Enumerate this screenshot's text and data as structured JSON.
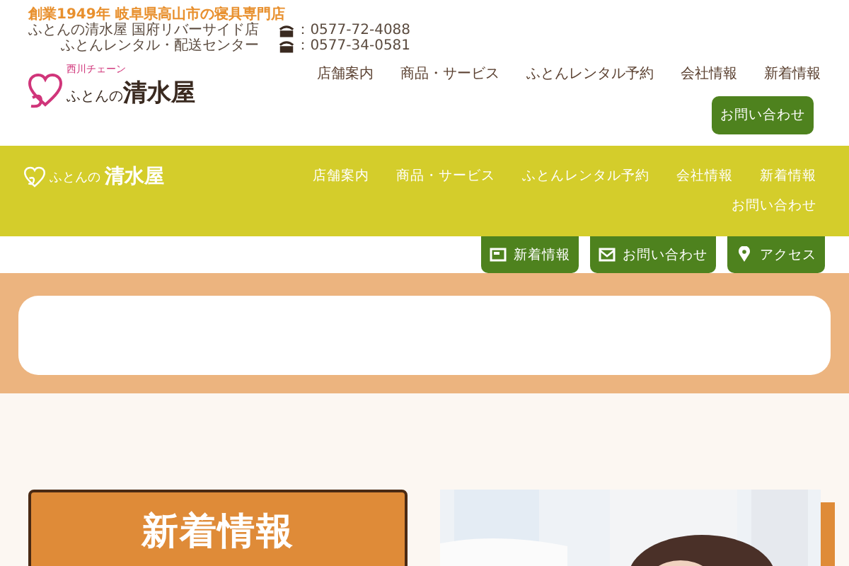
{
  "header": {
    "tagline": "創業1949年 岐阜県高山市の寝具専門店",
    "stores": [
      {
        "name": "ふとんの清水屋 国府リバーサイド店",
        "phone": "：0577-72-4088"
      },
      {
        "name": "ふとんレンタル・配送センター",
        "phone": "：0577-34-0581"
      }
    ],
    "logo": {
      "chain": "西川チェーン",
      "prefix": "ふとんの",
      "main": "清水屋"
    },
    "nav": [
      "店舗案内",
      "商品・サービス",
      "ふとんレンタル予約",
      "会社情報",
      "新着情報"
    ],
    "contact_button": "お問い合わせ"
  },
  "sticky_bar": {
    "logo": {
      "prefix": "ふとんの",
      "main": "清水屋"
    },
    "nav": [
      "店舗案内",
      "商品・サービス",
      "ふとんレンタル予約",
      "会社情報",
      "新着情報",
      "お問い合わせ"
    ]
  },
  "quick_links": [
    {
      "label": "新着情報",
      "kind": "news"
    },
    {
      "label": "お問い合わせ",
      "kind": "mail"
    },
    {
      "label": "アクセス",
      "kind": "pin"
    }
  ],
  "news_section": {
    "heading": "新着情報"
  }
}
